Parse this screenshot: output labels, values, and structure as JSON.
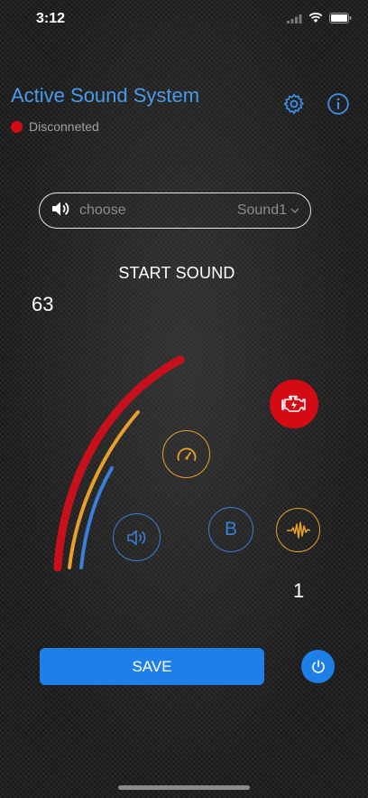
{
  "status_bar": {
    "time": "3:12"
  },
  "header": {
    "title": "Active Sound System",
    "connection_status": "Disconneted",
    "connection_color": "#d40a14"
  },
  "sound_selector": {
    "placeholder": "choose",
    "value": "Sound1",
    "icon": "speaker-icon"
  },
  "controls": {
    "start_label": "START SOUND",
    "gauge_value": "63",
    "counter": "1",
    "bass_label": "B",
    "save_label": "SAVE"
  },
  "colors": {
    "accent_blue": "#4a9be8",
    "button_blue": "#1f7fe8",
    "orange": "#e8a02a",
    "red": "#c8101c",
    "engine_red": "#d40a14"
  },
  "icons": [
    "gear-icon",
    "info-icon",
    "engine-icon",
    "speedometer-icon",
    "volume-icon",
    "bass-icon",
    "waveform-icon",
    "power-icon"
  ]
}
